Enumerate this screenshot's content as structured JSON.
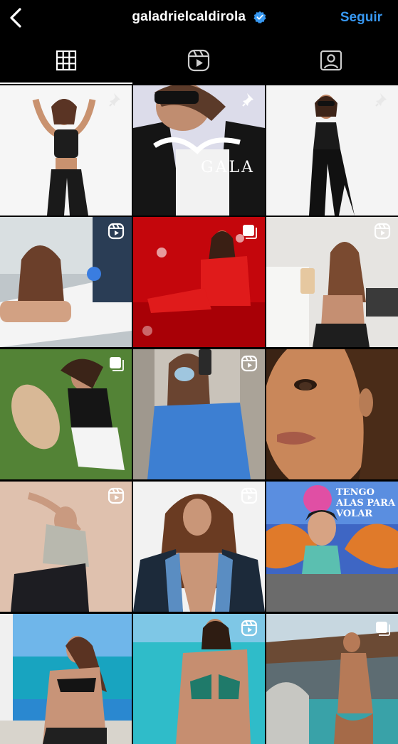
{
  "header": {
    "username": "galadrielcaldirola",
    "verified": true,
    "follow_label": "Seguir",
    "accent_color": "#3797f0"
  },
  "tabs": [
    {
      "icon": "grid-icon",
      "active": true
    },
    {
      "icon": "reels-icon",
      "active": false
    },
    {
      "icon": "tagged-icon",
      "active": false
    }
  ],
  "posts": [
    {
      "type": "pinned"
    },
    {
      "type": "pinned",
      "overlay_text": "GALA"
    },
    {
      "type": "pinned"
    },
    {
      "type": "reel"
    },
    {
      "type": "carousel"
    },
    {
      "type": "reel"
    },
    {
      "type": "carousel"
    },
    {
      "type": "reel"
    },
    {
      "type": "photo"
    },
    {
      "type": "reel"
    },
    {
      "type": "reel"
    },
    {
      "type": "photo",
      "overlay_text": "TENGO ALAS PARA VOLAR"
    },
    {
      "type": "photo"
    },
    {
      "type": "reel"
    },
    {
      "type": "carousel"
    }
  ]
}
